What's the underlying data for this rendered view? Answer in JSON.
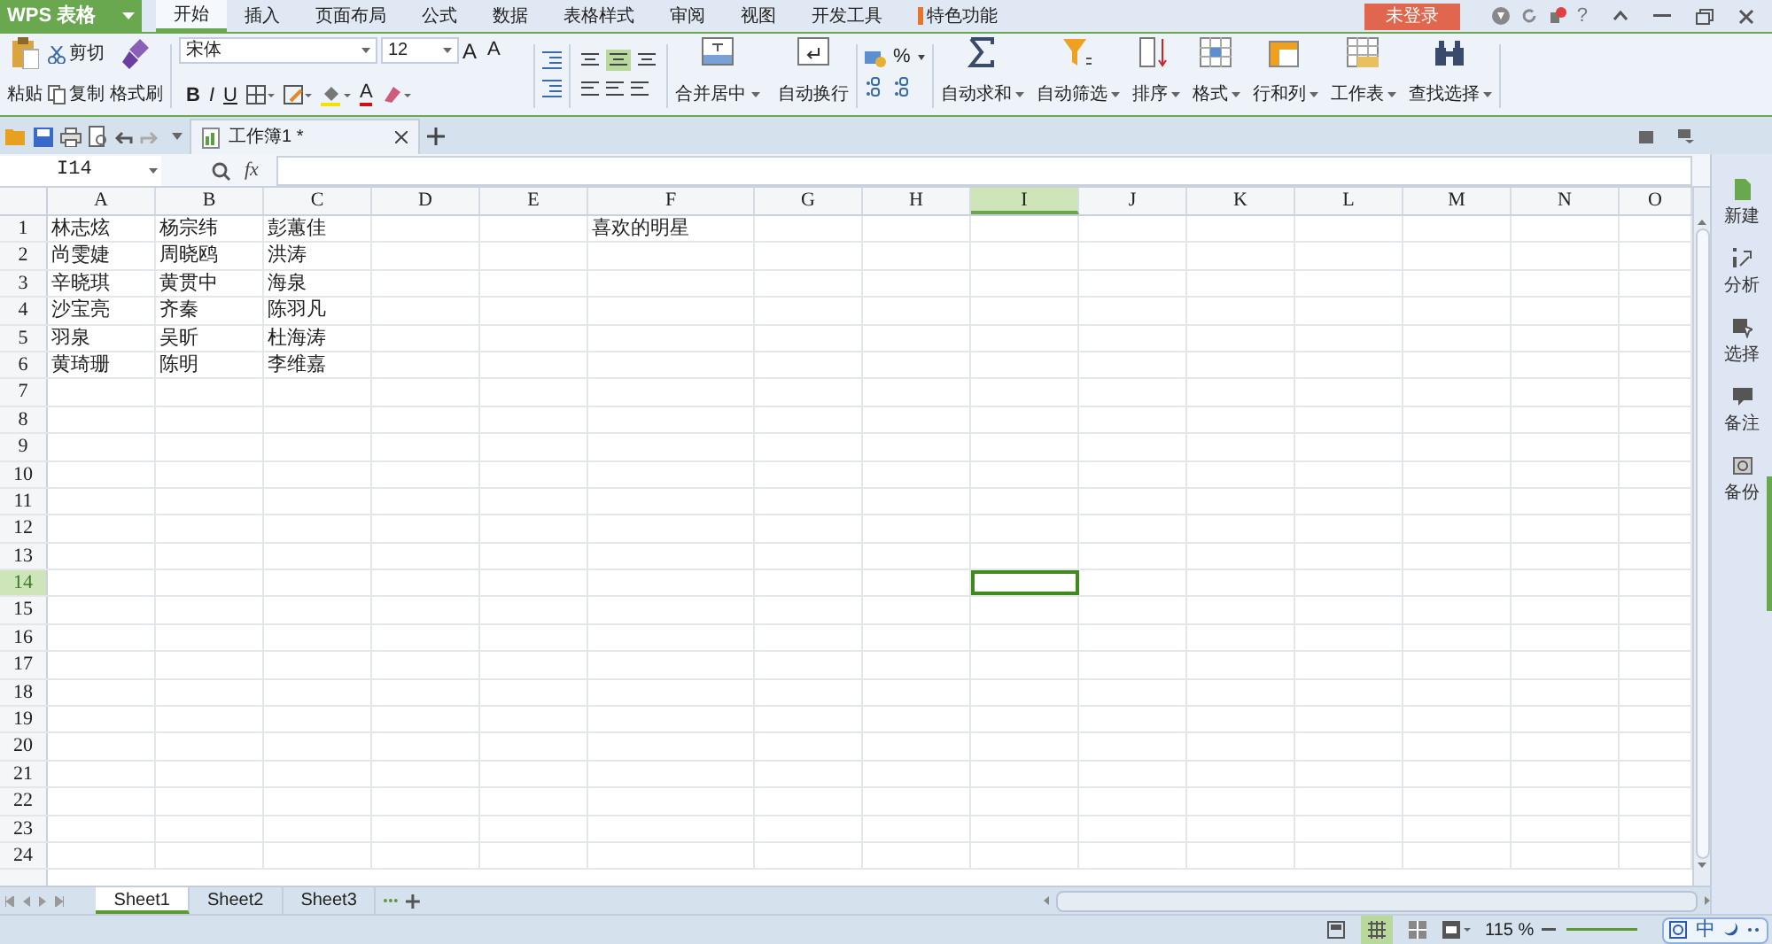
{
  "app_button": {
    "label": "WPS 表格"
  },
  "menu_tabs": [
    {
      "label": "开始",
      "selected": true
    },
    {
      "label": "插入",
      "selected": false
    },
    {
      "label": "页面布局",
      "selected": false
    },
    {
      "label": "公式",
      "selected": false
    },
    {
      "label": "数据",
      "selected": false
    },
    {
      "label": "表格样式",
      "selected": false
    },
    {
      "label": "审阅",
      "selected": false
    },
    {
      "label": "视图",
      "selected": false
    },
    {
      "label": "开发工具",
      "selected": false
    },
    {
      "label": "特色功能",
      "selected": false,
      "kind": "featured"
    }
  ],
  "login_button": "未登录",
  "help_glyph": "?",
  "ribbon": {
    "paste": "粘贴",
    "cut": "剪切",
    "copy": "复制",
    "format_painter": "格式刷",
    "font_name": "宋体",
    "font_size": "12",
    "grow_font": "A",
    "shrink_font": "A",
    "bold": "B",
    "italic": "I",
    "underline": "U",
    "font_color": "A",
    "percent": "%",
    "merge": "合并居中",
    "wrap": "自动换行",
    "autosum": "自动求和",
    "autofilter": "自动筛选",
    "sort": "排序",
    "format": "格式",
    "rows_cols": "行和列",
    "worksheet": "工作表",
    "find": "查找选择"
  },
  "vertical_align": [
    {
      "selected": false
    },
    {
      "selected": true
    },
    {
      "selected": false
    }
  ],
  "doc_tab": {
    "title": "工作簿1 *"
  },
  "name_box": "I14",
  "function_label": "fx",
  "columns": [
    {
      "label": "A",
      "selected": false
    },
    {
      "label": "B",
      "selected": false
    },
    {
      "label": "C",
      "selected": false
    },
    {
      "label": "D",
      "selected": false
    },
    {
      "label": "E",
      "selected": false
    },
    {
      "label": "F",
      "selected": false
    },
    {
      "label": "G",
      "selected": false
    },
    {
      "label": "H",
      "selected": false
    },
    {
      "label": "I",
      "selected": true
    },
    {
      "label": "J",
      "selected": false
    },
    {
      "label": "K",
      "selected": false
    },
    {
      "label": "L",
      "selected": false
    },
    {
      "label": "M",
      "selected": false
    },
    {
      "label": "N",
      "selected": false
    },
    {
      "label": "O",
      "selected": false
    }
  ],
  "rows": [
    {
      "label": "1",
      "selected": false,
      "cells": [
        "林志炫",
        "杨宗纬",
        "彭蕙佳"
      ],
      "column_f": "喜欢的明星"
    },
    {
      "label": "2",
      "selected": false,
      "cells": [
        "尚雯婕",
        "周晓鸥",
        "洪涛"
      ]
    },
    {
      "label": "3",
      "selected": false,
      "cells": [
        "辛晓琪",
        "黄贯中",
        "海泉"
      ]
    },
    {
      "label": "4",
      "selected": false,
      "cells": [
        "沙宝亮",
        "齐秦",
        "陈羽凡"
      ]
    },
    {
      "label": "5",
      "selected": false,
      "cells": [
        "羽泉",
        "吴昕",
        "杜海涛"
      ]
    },
    {
      "label": "6",
      "selected": false,
      "cells": [
        "黄琦珊",
        "陈明",
        "李维嘉"
      ]
    },
    {
      "label": "7",
      "selected": false
    },
    {
      "label": "8",
      "selected": false
    },
    {
      "label": "9",
      "selected": false
    },
    {
      "label": "10",
      "selected": false
    },
    {
      "label": "11",
      "selected": false
    },
    {
      "label": "12",
      "selected": false
    },
    {
      "label": "13",
      "selected": false
    },
    {
      "label": "14",
      "selected": true
    },
    {
      "label": "15",
      "selected": false
    },
    {
      "label": "16",
      "selected": false
    },
    {
      "label": "17",
      "selected": false
    },
    {
      "label": "18",
      "selected": false
    },
    {
      "label": "19",
      "selected": false
    },
    {
      "label": "20",
      "selected": false
    },
    {
      "label": "21",
      "selected": false
    },
    {
      "label": "22",
      "selected": false
    },
    {
      "label": "23",
      "selected": false
    },
    {
      "label": "24",
      "selected": false
    }
  ],
  "sheet_tabs": [
    {
      "label": "Sheet1",
      "selected": true
    },
    {
      "label": "Sheet2",
      "selected": false
    },
    {
      "label": "Sheet3",
      "selected": false
    }
  ],
  "sidebar": [
    {
      "label": "新建"
    },
    {
      "label": "分析"
    },
    {
      "label": "选择"
    },
    {
      "label": "备注"
    },
    {
      "label": "备份"
    }
  ],
  "view_modes": [
    {
      "selected": false
    },
    {
      "selected": true
    },
    {
      "selected": false
    }
  ],
  "zoom": "115 %",
  "ime": "中"
}
